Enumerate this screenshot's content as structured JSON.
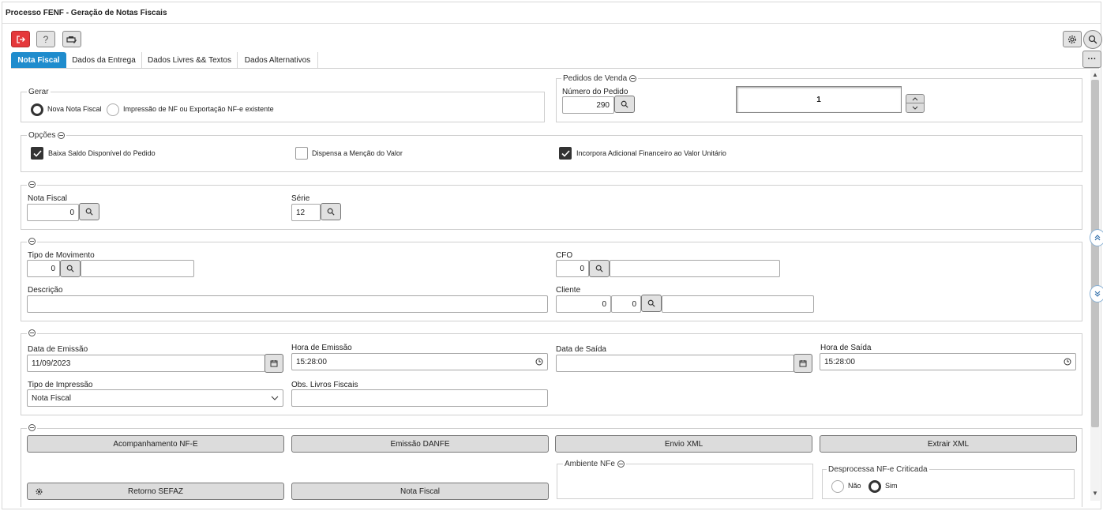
{
  "window": {
    "title": "Processo FENF - Geração de Notas Fiscais"
  },
  "toolbar": {
    "exit_icon": "exit-icon",
    "help_label": "?",
    "print_icon": "printer-icon",
    "settings_icon": "gear-icon",
    "search_icon": "search-icon",
    "more_label": "···"
  },
  "tabs": [
    {
      "label": "Nota Fiscal",
      "active": true
    },
    {
      "label": "Dados da Entrega"
    },
    {
      "label": "Dados Livres && Textos"
    },
    {
      "label": "Dados Alternativos"
    }
  ],
  "gerar": {
    "legend": "Gerar",
    "options": [
      "Nova Nota Fiscal",
      "Impressão de NF ou Exportação NF-e existente"
    ],
    "selected": "Nova Nota Fiscal"
  },
  "pedidos": {
    "legend": "Pedidos de Venda",
    "numero_label": "Número do Pedido",
    "numero_value": "290",
    "count_value": "1"
  },
  "opcoes": {
    "legend": "Opções",
    "items": [
      {
        "label": "Baixa Saldo Disponível do Pedido",
        "checked": true
      },
      {
        "label": "Dispensa a Menção do Valor",
        "checked": false
      },
      {
        "label": "Incorpora Adicional Financeiro ao Valor Unitário",
        "checked": true
      }
    ]
  },
  "nota": {
    "nota_label": "Nota Fiscal",
    "nota_value": "0",
    "serie_label": "Série",
    "serie_value": "12"
  },
  "movimento": {
    "tipo_label": "Tipo de Movimento",
    "tipo_value": "0",
    "cfo_label": "CFO",
    "cfo_value": "0",
    "descricao_label": "Descrição",
    "cliente_label": "Cliente",
    "cliente_value1": "0",
    "cliente_value2": "0"
  },
  "datas": {
    "emissao_label": "Data de Emissão",
    "emissao_value": "11/09/2023",
    "hora_emissao_label": "Hora de Emissão",
    "hora_emissao_value": "15:28:00",
    "saida_label": "Data de Saída",
    "saida_value": "",
    "hora_saida_label": "Hora de Saída",
    "hora_saida_value": "15:28:00",
    "tipo_impressao_label": "Tipo de Impressão",
    "tipo_impressao_value": "Nota Fiscal",
    "obs_label": "Obs. Livros Fiscais"
  },
  "acoes": {
    "buttons_row1": [
      "Acompanhamento NF-E",
      "Emissão DANFE",
      "Envio XML",
      "Extrair XML"
    ],
    "retorno_label": "Retorno SEFAZ",
    "nota_fiscal_label": "Nota Fiscal",
    "ambiente_legend": "Ambiente NFe",
    "desprocessa_legend": "Desprocessa NF-e Criticada",
    "desprocessa_options": [
      "Não",
      "Sim"
    ],
    "desprocessa_selected": "Sim"
  },
  "colors": {
    "accent": "#1f8ccd",
    "exit": "#e5383b"
  }
}
